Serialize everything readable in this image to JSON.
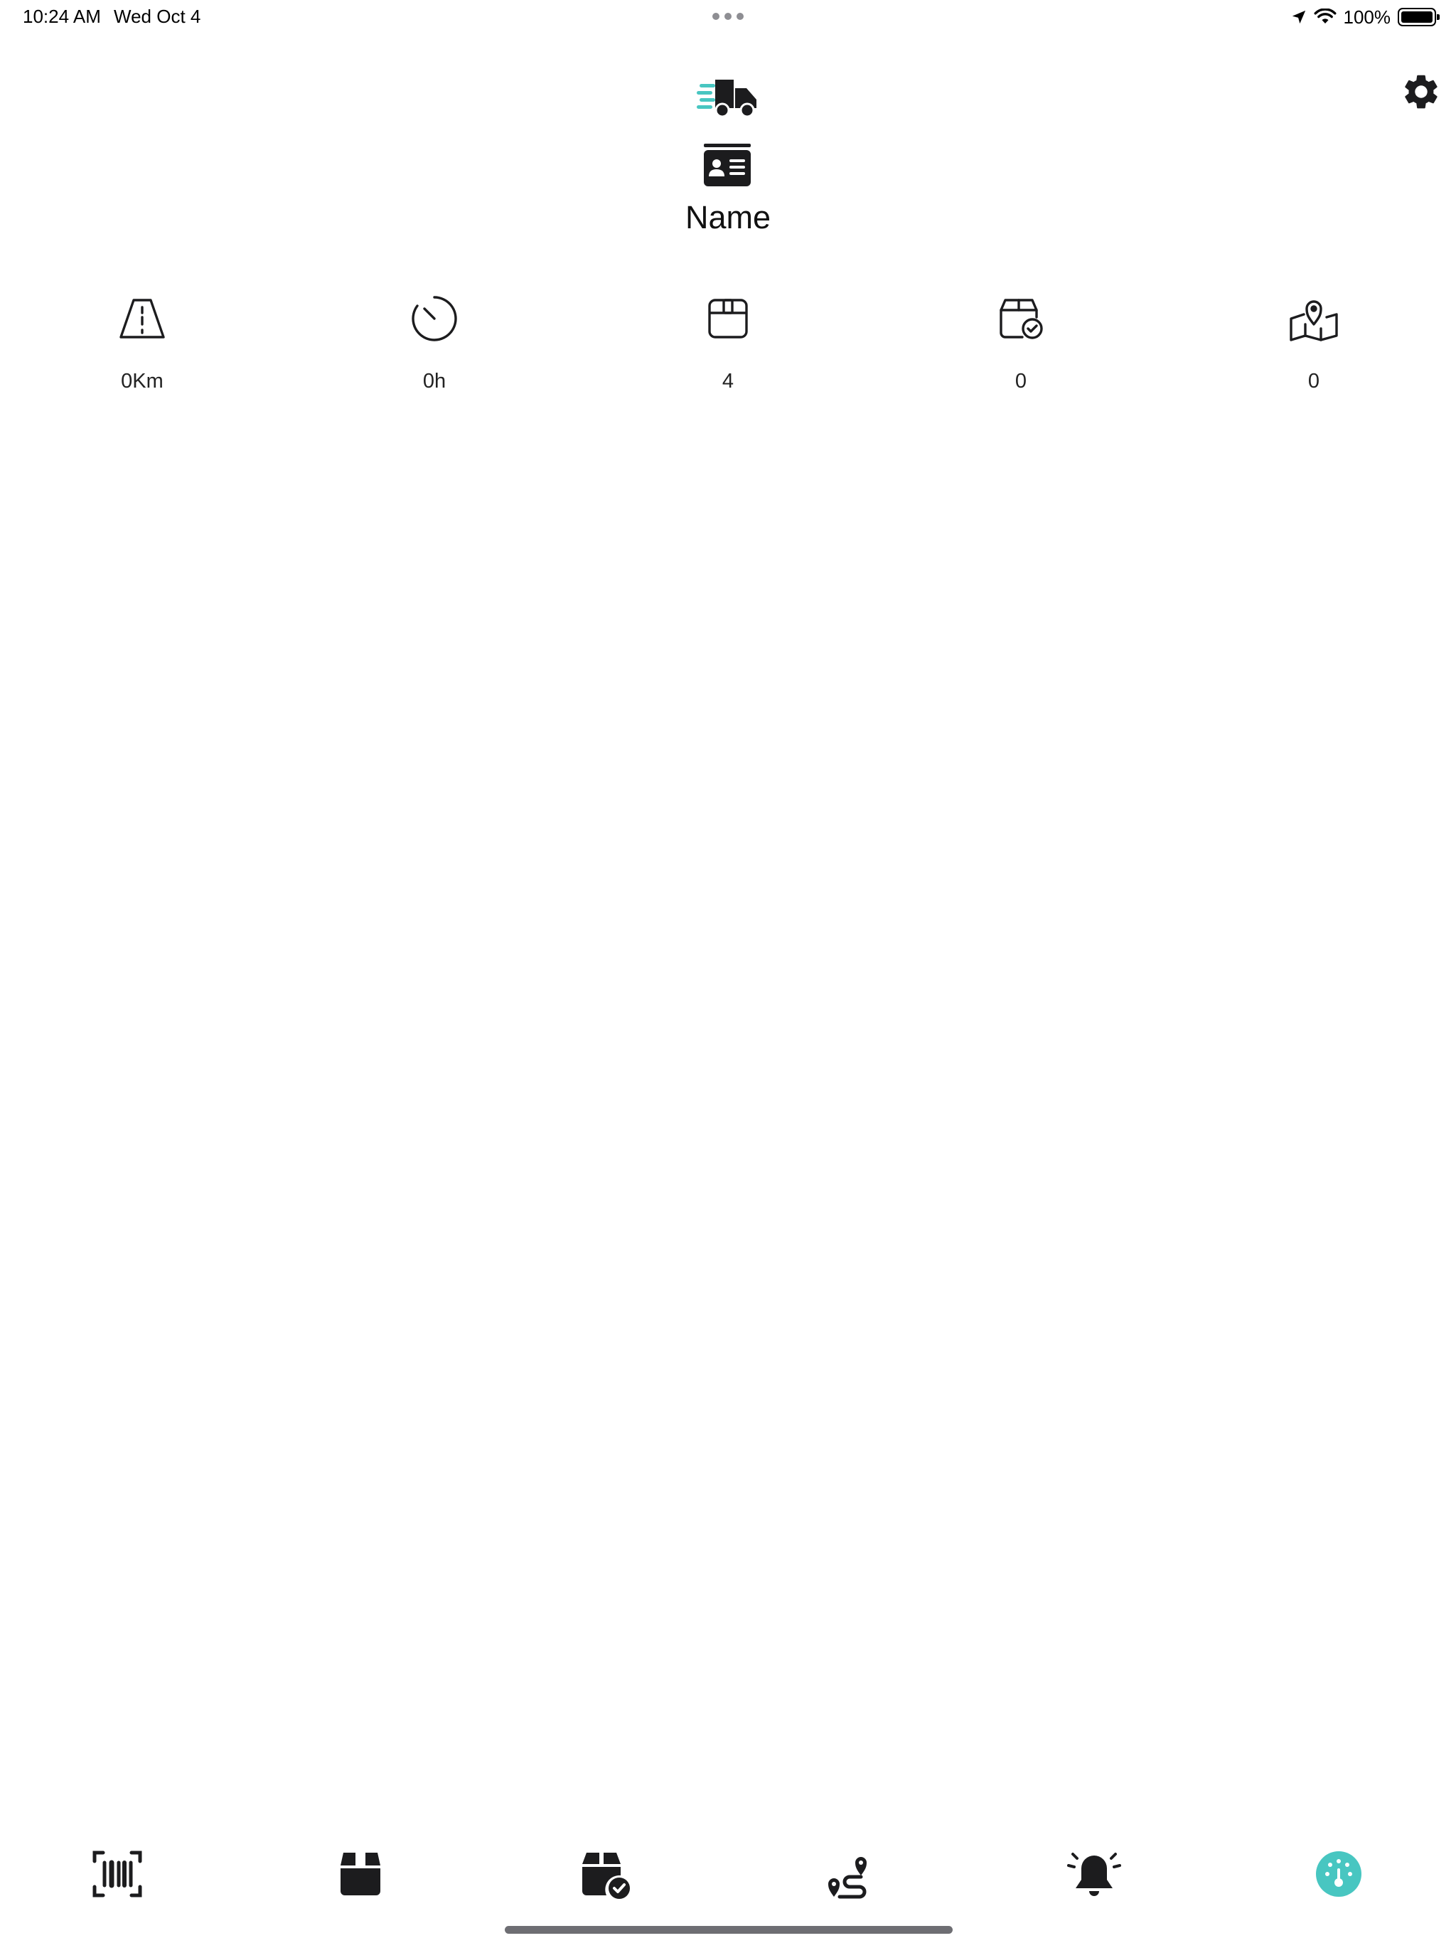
{
  "status_bar": {
    "time": "10:24 AM",
    "date": "Wed Oct 4",
    "battery": "100%"
  },
  "header": {
    "logo_icon": "delivery-truck-icon",
    "settings_icon": "gear-icon",
    "id_icon": "id-card-icon",
    "name": "Name"
  },
  "stats": [
    {
      "icon": "road-icon",
      "value": "0Km"
    },
    {
      "icon": "timer-icon",
      "value": "0h"
    },
    {
      "icon": "package-icon",
      "value": "4"
    },
    {
      "icon": "package-delivered-icon",
      "value": "0"
    },
    {
      "icon": "map-pin-icon",
      "value": "0"
    }
  ],
  "tab_bar": {
    "items": [
      {
        "icon": "barcode-scan-icon",
        "active": false
      },
      {
        "icon": "package-icon",
        "active": false
      },
      {
        "icon": "package-delivered-icon",
        "active": false
      },
      {
        "icon": "route-icon",
        "active": false
      },
      {
        "icon": "alarm-bell-icon",
        "active": false
      },
      {
        "icon": "dashboard-gauge-icon",
        "active": true
      }
    ]
  },
  "colors": {
    "accent": "#48c6c1",
    "icon": "#1c1c1e",
    "background": "#ffffff"
  }
}
